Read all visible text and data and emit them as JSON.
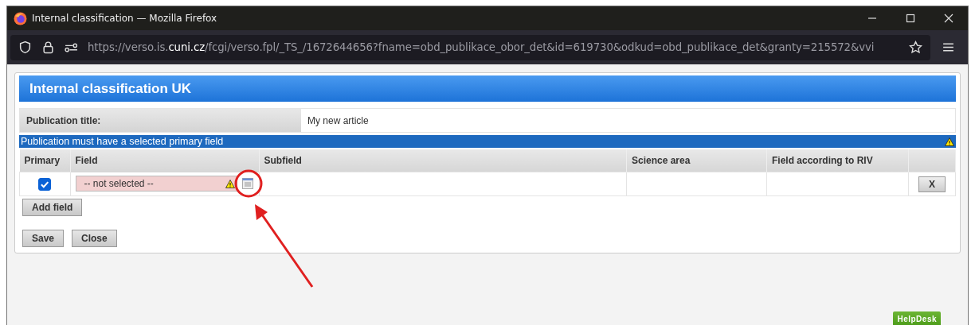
{
  "window": {
    "title": "Internal classification — Mozilla Firefox"
  },
  "address_bar": {
    "url_prefix": "https://verso.is.",
    "url_domain": "cuni.cz",
    "url_rest": "/fcgi/verso.fpl/_TS_/1672644656?fname=obd_publikace_obor_det&id=619730&odkud=obd_publikace_det&granty=215572&vvi"
  },
  "page": {
    "heading": "Internal classification UK",
    "title_label": "Publication title:",
    "title_value": "My new article",
    "error": "Publication must have a selected primary field",
    "table": {
      "columns": [
        "Primary",
        "Field",
        "Subfield",
        "Science area",
        "Field according to RIV"
      ],
      "rows": [
        {
          "primary": true,
          "field": "-- not selected --",
          "field_invalid": true,
          "subfield": "",
          "science_area": "",
          "riv": "",
          "remove": "X"
        }
      ]
    },
    "add_button": "Add field",
    "buttons": [
      "Save",
      "Close"
    ],
    "helpdesk": "HelpDesk"
  }
}
